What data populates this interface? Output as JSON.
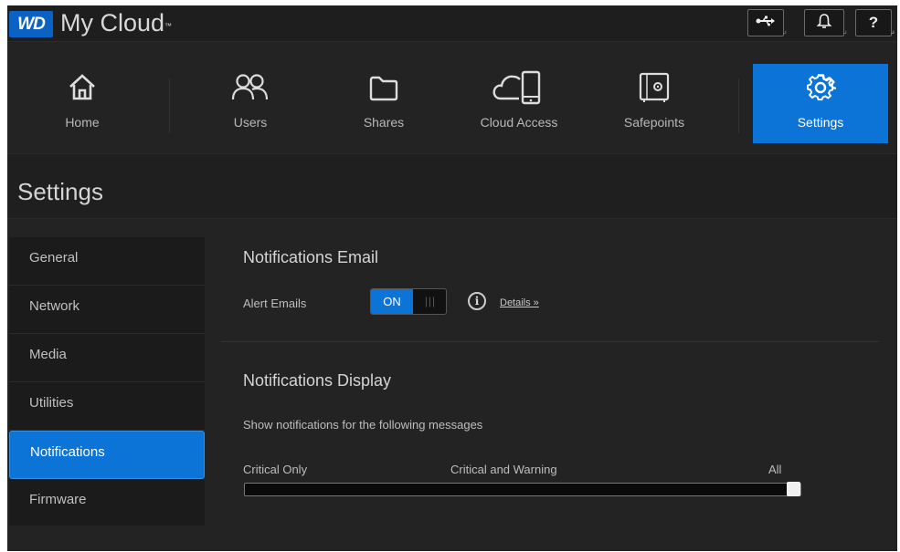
{
  "app": {
    "logo_text": "WD",
    "title": "My Cloud",
    "trademark": "™"
  },
  "topbar_icons": [
    {
      "name": "usb-icon",
      "glyph": "⭠"
    },
    {
      "name": "bell-icon",
      "glyph": "🔔"
    },
    {
      "name": "help-icon",
      "glyph": "?"
    }
  ],
  "nav": {
    "tabs": [
      {
        "label": "Home",
        "icon": "home-icon"
      },
      {
        "label": "Users",
        "icon": "users-icon"
      },
      {
        "label": "Shares",
        "icon": "folder-icon"
      },
      {
        "label": "Cloud Access",
        "icon": "cloud-device-icon"
      },
      {
        "label": "Safepoints",
        "icon": "safe-icon"
      },
      {
        "label": "Settings",
        "icon": "gear-icon",
        "active": true
      }
    ],
    "active_color": "#0b74d6"
  },
  "page": {
    "title": "Settings"
  },
  "sidebar": {
    "items": [
      {
        "label": "General"
      },
      {
        "label": "Network"
      },
      {
        "label": "Media"
      },
      {
        "label": "Utilities"
      },
      {
        "label": "Notifications",
        "active": true
      },
      {
        "label": "Firmware"
      }
    ]
  },
  "notifications_email": {
    "title": "Notifications Email",
    "alert_label": "Alert Emails",
    "toggle_state": "ON",
    "toggle_grip": "|||",
    "info_glyph": "i",
    "details_link": "Details »"
  },
  "notifications_display": {
    "title": "Notifications Display",
    "description": "Show notifications for the following messages",
    "levels": [
      "Critical Only",
      "Critical and Warning",
      "All"
    ],
    "selected_level": "All",
    "slider_value": 1.0
  }
}
